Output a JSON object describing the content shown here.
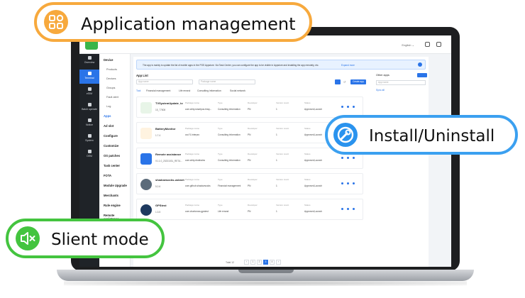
{
  "callouts": {
    "app_management": "Application management",
    "install_uninstall": "Install/Uninstall",
    "silent_mode": "Slient mode"
  },
  "colors": {
    "orange": "#f7a93d",
    "blue": "#3ba0f0",
    "green": "#44c43f",
    "accent": "#2a74e8"
  },
  "topbar": {
    "language": "English ⌄"
  },
  "sidebar": [
    {
      "label": "Overview",
      "icon": "grid-icon"
    },
    {
      "label": "Terminal",
      "icon": "terminal-icon",
      "active": true
    },
    {
      "label": "eSIM",
      "icon": "sim-icon"
    },
    {
      "label": "Batch operate",
      "icon": "batch-icon"
    },
    {
      "label": "Notice",
      "icon": "bell-icon"
    },
    {
      "label": "System",
      "icon": "gear-icon"
    },
    {
      "label": "OEM",
      "icon": "oem-icon"
    }
  ],
  "submenu": {
    "device_head": "Device",
    "items": [
      "Products",
      "Devices",
      "Groups",
      "Fault alert",
      "Log"
    ],
    "heads": [
      "Apps",
      "Ad slot",
      "Configure",
      "Customize",
      "OS patches",
      "Task center",
      "FOTA",
      "Module Upgrade",
      "Merchants",
      "Rule engine",
      "Remote assistance"
    ]
  },
  "notice": {
    "text": "The app is mainly to update the list of mobile apps in the POS Appstore. Via Task Center, you can configure the app to be visible in Appstore and installing the app remotely, etc.",
    "link": "Expand more"
  },
  "app_list": {
    "title": "App List",
    "app_name_placeholder": "App name",
    "package_name_placeholder": "Package name",
    "create_label": "Create app",
    "tabs": [
      "Tool",
      "Financial management",
      "Life errand",
      "Consulting information",
      "Social network"
    ],
    "col_headers": {
      "package": "Package name",
      "type": "Type",
      "developer": "Developer",
      "version_count": "Version count",
      "status": "Status"
    },
    "rows": [
      {
        "name": "TVSystemUpdate_tv",
        "version": "15_77808",
        "package": "com.whty.smartpos.tmsy...",
        "type": "Consulting information",
        "developer": "PN",
        "count": "1",
        "status": "Approved,Launch"
      },
      {
        "name": "BatteryMonitor",
        "version": "1.7.4",
        "package": "ccc?1.Interpro",
        "type": "Consulting information",
        "developer": "PN",
        "count": "1",
        "status": "Approved,Launch"
      },
      {
        "name": "Remote assistance",
        "version": "V1.1.0_20231031_RETA...",
        "package": "com.whty.droidrainc",
        "type": "Consulting information",
        "developer": "PN",
        "count": "1",
        "status": "Approved,Launch"
      },
      {
        "name": "shadowsocks-usbnet",
        "version": "5.2.6",
        "package": "com.github.shadowsocks",
        "type": "Financial management",
        "developer": "PN",
        "count": "1",
        "status": "Approved,Launch"
      },
      {
        "name": "GPStest",
        "version": "1.3.5",
        "package": "com.chartcross.gpstest",
        "type": "Life errand",
        "developer": "PN",
        "count": "1",
        "status": "Approved,Launch"
      }
    ],
    "pager": {
      "total": "Total 12",
      "pages": [
        "1",
        "2",
        "3",
        "4"
      ],
      "active": "3"
    }
  },
  "other_apps": {
    "title": "Other apps",
    "placeholder": "App name",
    "link": "Sync all"
  }
}
